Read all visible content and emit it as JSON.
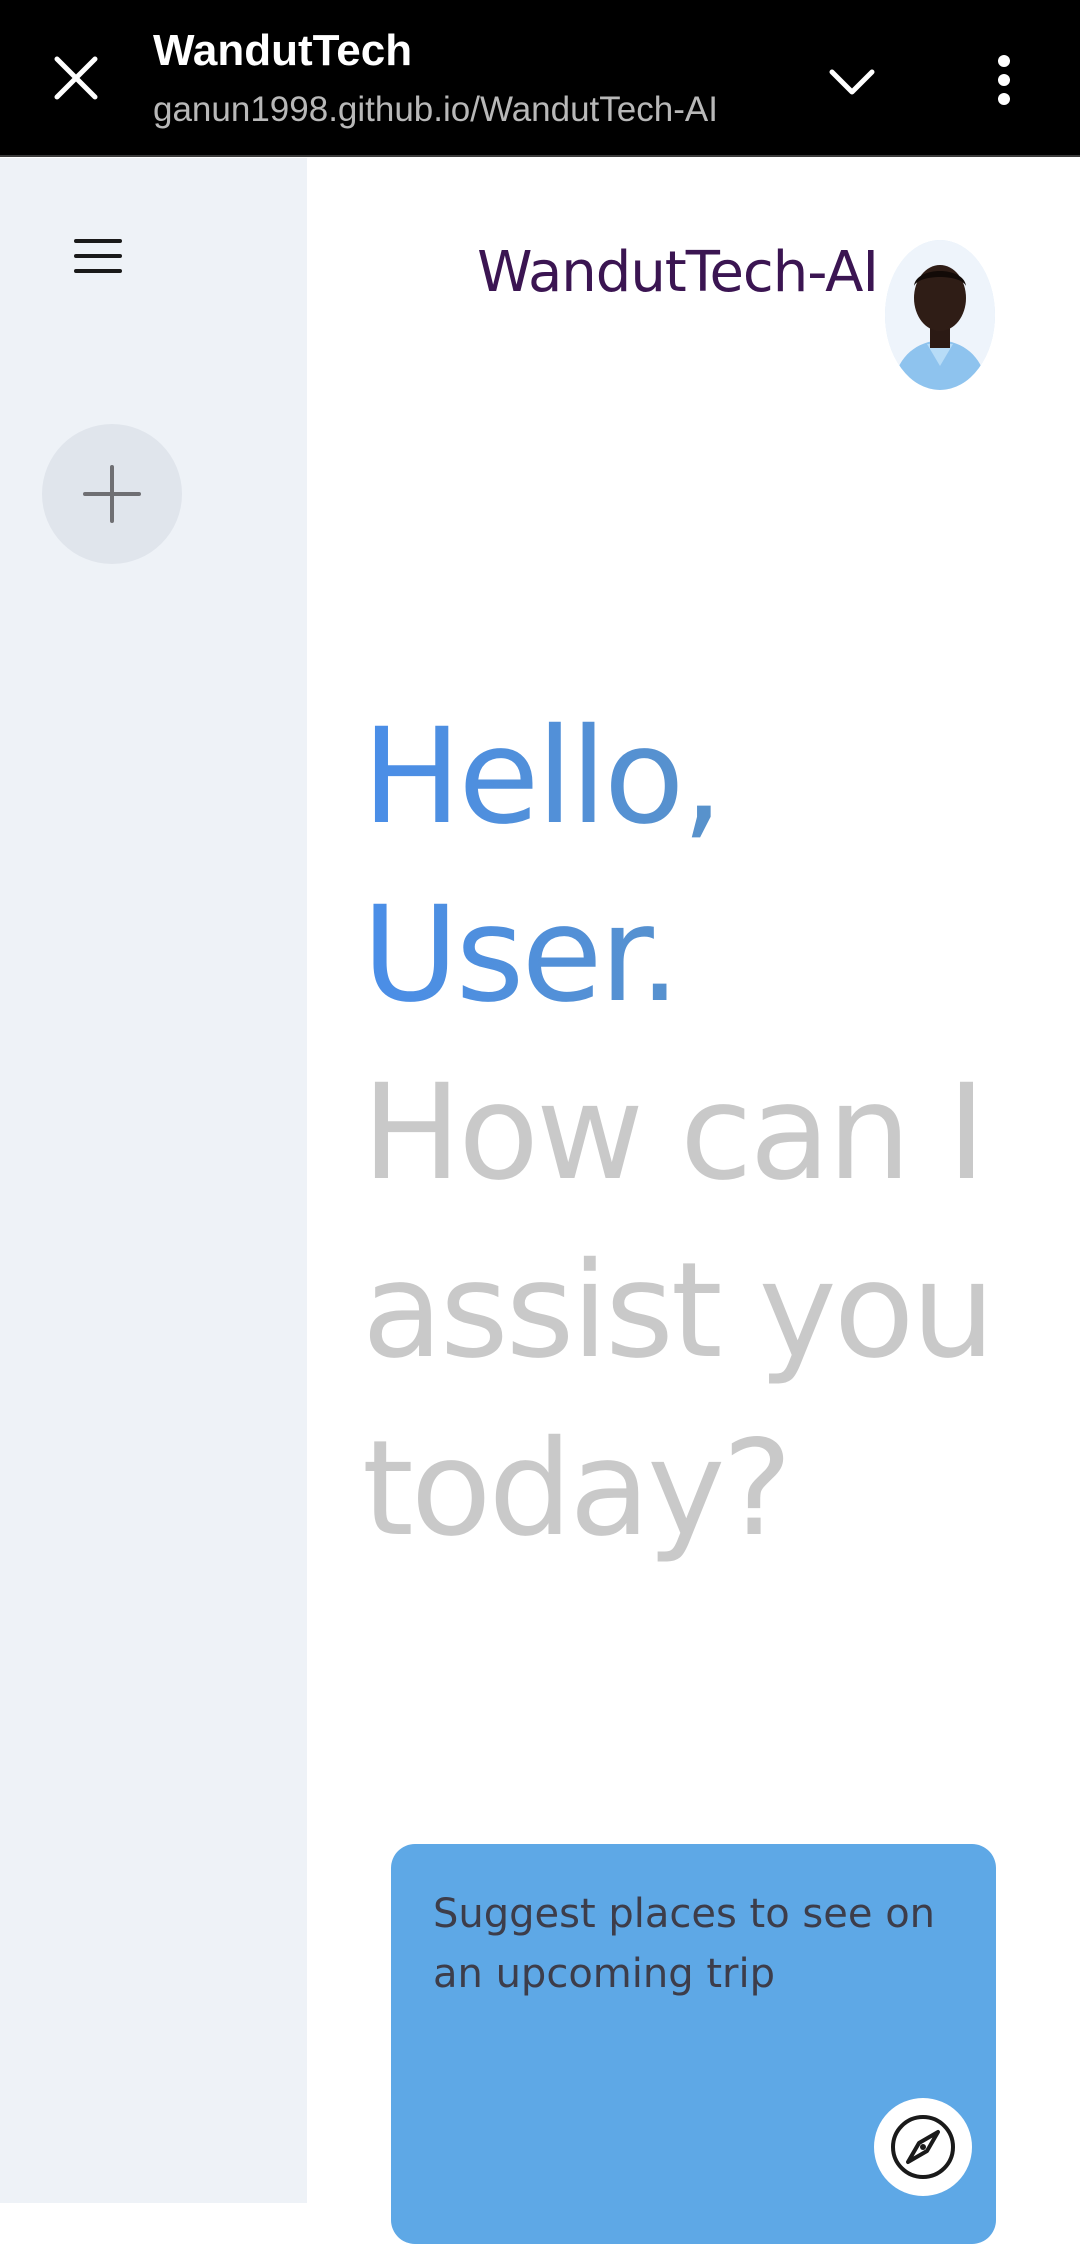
{
  "browser": {
    "title": "WandutTech",
    "url": "ganun1998.github.io/WandutTech-AI"
  },
  "header": {
    "brand": "WandutTech-AI"
  },
  "greeting": {
    "line1": "Hello,",
    "line2": "User.",
    "line3": "How can I",
    "line4": "assist you",
    "line5": "today?"
  },
  "suggestions": [
    {
      "text": "Suggest places to see on an upcoming trip",
      "icon": "compass-icon"
    }
  ],
  "colors": {
    "brand_text": "#3b1552",
    "greeting_gradient_start": "#4a8ee8",
    "muted_text": "#c9c9c9",
    "card_bg": "#5ea8e6",
    "sidebar_bg": "#eef2f7"
  }
}
